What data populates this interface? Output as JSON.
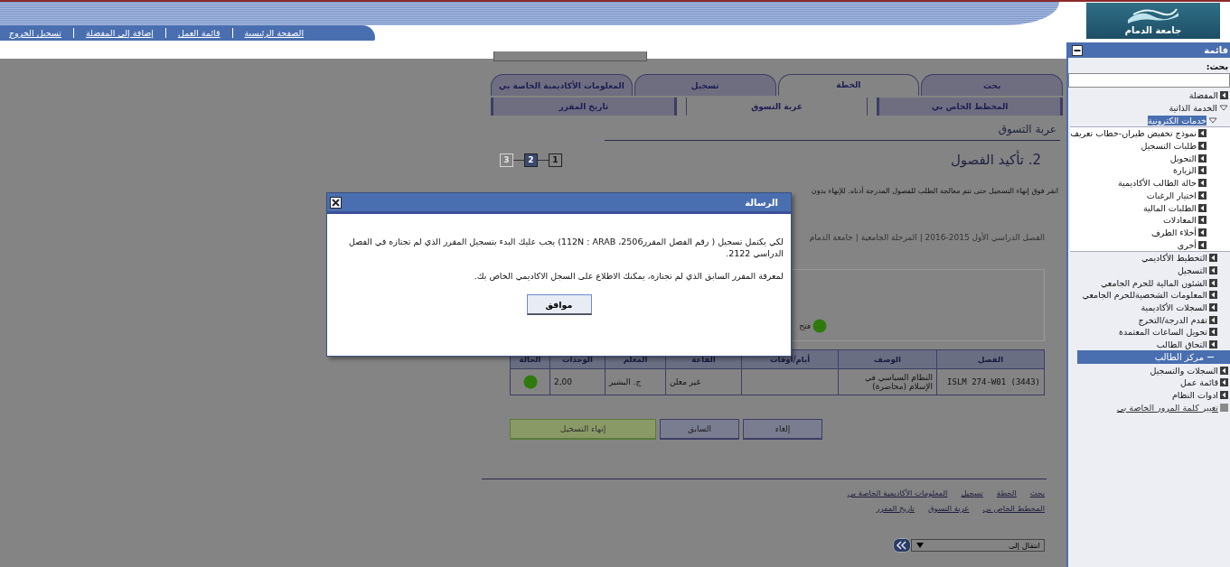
{
  "header": {
    "logo_text": "جامعة الدمام",
    "nav_links": [
      "الصفحة الرئيسية",
      "قائمة العمل",
      "إضافة إلى المفضلة",
      "تسجيل الخروج"
    ]
  },
  "main": {
    "tabs": [
      {
        "label": "بحث",
        "selected": false
      },
      {
        "label": "الخطة",
        "selected": true
      },
      {
        "label": "تسجيل",
        "selected": false
      },
      {
        "label": "المعلومات الأكاديمية الخاصة بي",
        "selected": false
      }
    ],
    "subtabs": [
      {
        "label": "المخطط الخاص بي",
        "selected": false
      },
      {
        "label": "عربة التسوق",
        "selected": true
      },
      {
        "label": "تاريخ المقرر",
        "selected": false
      }
    ],
    "page_title": "عربة التسوق",
    "step_title": "2. تأكيد الفصول",
    "steps": [
      {
        "label": "1",
        "selected": false,
        "disabled": false
      },
      {
        "label": "2",
        "selected": true,
        "disabled": false
      },
      {
        "label": "3",
        "selected": false,
        "disabled": true
      }
    ],
    "instructions": "انقر فوق إنهاء التسجيل حتى تتم معالجة الطلب للفصول المدرجة أدناه. للإنهاء بدون",
    "term": "الفصل الدراسي الأول 2015-2016 | المرحلة الجامعية | جامعة الدمام",
    "legend": [
      {
        "label": "فتح",
        "color": "#2f7a0c"
      }
    ],
    "table": {
      "columns": [
        "الفصل",
        "الوصف",
        "أيام/أوقات",
        "القاعة",
        "المعلم",
        "الوحدات",
        "الحالة"
      ],
      "rows": [
        {
          "class": "ISLM 274-W01 (3443)",
          "description": "النظام السياسي في الإسلام (محاضرة)",
          "room": "غير معلن",
          "instructor": "ج. البشير",
          "units": "2,00",
          "color": "#2f7a0c"
        }
      ]
    },
    "buttons": [
      {
        "label": "إلغاء",
        "kind": "normal"
      },
      {
        "label": "السابق",
        "kind": "normal"
      },
      {
        "label": "إنهاء التسجيل",
        "kind": "primary"
      }
    ],
    "footer_links": [
      [
        "بحث",
        "الخطة",
        "تسجيل",
        "المعلومات الأكاديمية الخاصة بي"
      ],
      [
        "المخطط الخاص بي",
        "عربة التسوق",
        "تاريخ المقرر"
      ]
    ],
    "jump": {
      "value": "انتقال إلى"
    }
  },
  "sidebar": {
    "title": "قائمة",
    "search_label": "بحث:",
    "items": [
      {
        "label": "المفضلة",
        "expanded": false,
        "selected": false
      },
      {
        "label": "الخدمة الذاتية",
        "expanded": true,
        "selected": false,
        "children": [
          {
            "label": "خدمات الكترونية",
            "expanded": true,
            "selected": true,
            "children": [
              {
                "label": "نموذج تخفيض طيران-خطاب تعريف",
                "expanded": false,
                "selected": false
              },
              {
                "label": "طلبات التسجيل",
                "expanded": false,
                "selected": false
              },
              {
                "label": "التحويل",
                "expanded": false,
                "selected": false
              },
              {
                "label": "الزيارة",
                "expanded": false,
                "selected": false
              },
              {
                "label": "حالة الطالب الأكاديمية",
                "expanded": false,
                "selected": false
              },
              {
                "label": "اختيار الرغبات",
                "expanded": false,
                "selected": false
              },
              {
                "label": "الطلبات المالية",
                "expanded": false,
                "selected": false
              },
              {
                "label": "المعادلات",
                "expanded": false,
                "selected": false
              },
              {
                "label": "أخلاء الطرف",
                "expanded": false,
                "selected": false
              },
              {
                "label": "أخرى",
                "expanded": false,
                "selected": false
              }
            ]
          },
          {
            "label": "التخطيط الأكاديمي",
            "expanded": false,
            "selected": false
          },
          {
            "label": "التسجيل",
            "expanded": false,
            "selected": false
          },
          {
            "label": "الشئون المالية للحرم الجامعي",
            "expanded": false,
            "selected": false
          },
          {
            "label": "المعلومات الشخصيةللحرم الجامعي",
            "expanded": false,
            "selected": false
          },
          {
            "label": "السجلات الأكاديمية",
            "expanded": false,
            "selected": false
          },
          {
            "label": "تقدم الدرجة/التخرج",
            "expanded": false,
            "selected": false
          },
          {
            "label": "تحويل الساعات المعتمدة",
            "expanded": false,
            "selected": false
          },
          {
            "label": "التحاق الطالب",
            "expanded": false,
            "selected": false
          }
        ]
      }
    ],
    "section": {
      "label": "مركز الطالب",
      "expanded": true,
      "items": [
        {
          "label": "السجلات والتسجيل",
          "expanded": false,
          "selected": false
        },
        {
          "label": "قائمة عمل",
          "expanded": false,
          "selected": false
        },
        {
          "label": "ادوات النظام",
          "expanded": false,
          "selected": false
        }
      ]
    },
    "link": "تغيير كلمة المرور الخاصة بي"
  },
  "dialog": {
    "title": "الرسالة",
    "paragraphs": [
      "لكي يكتمل تسجيل  ( رقم الفصل المقرر2506، 112N : ARAB) يجب عليك البدء بتسجيل المقرر  الذي لم تجتازه في الفصل الدراسي 2122.",
      "لمعرفة المقرر السابق الذي لم تجتازه، يمكنك الاطلاع على السجل الاكاديمي الخاص بك."
    ],
    "button": "موافق"
  }
}
